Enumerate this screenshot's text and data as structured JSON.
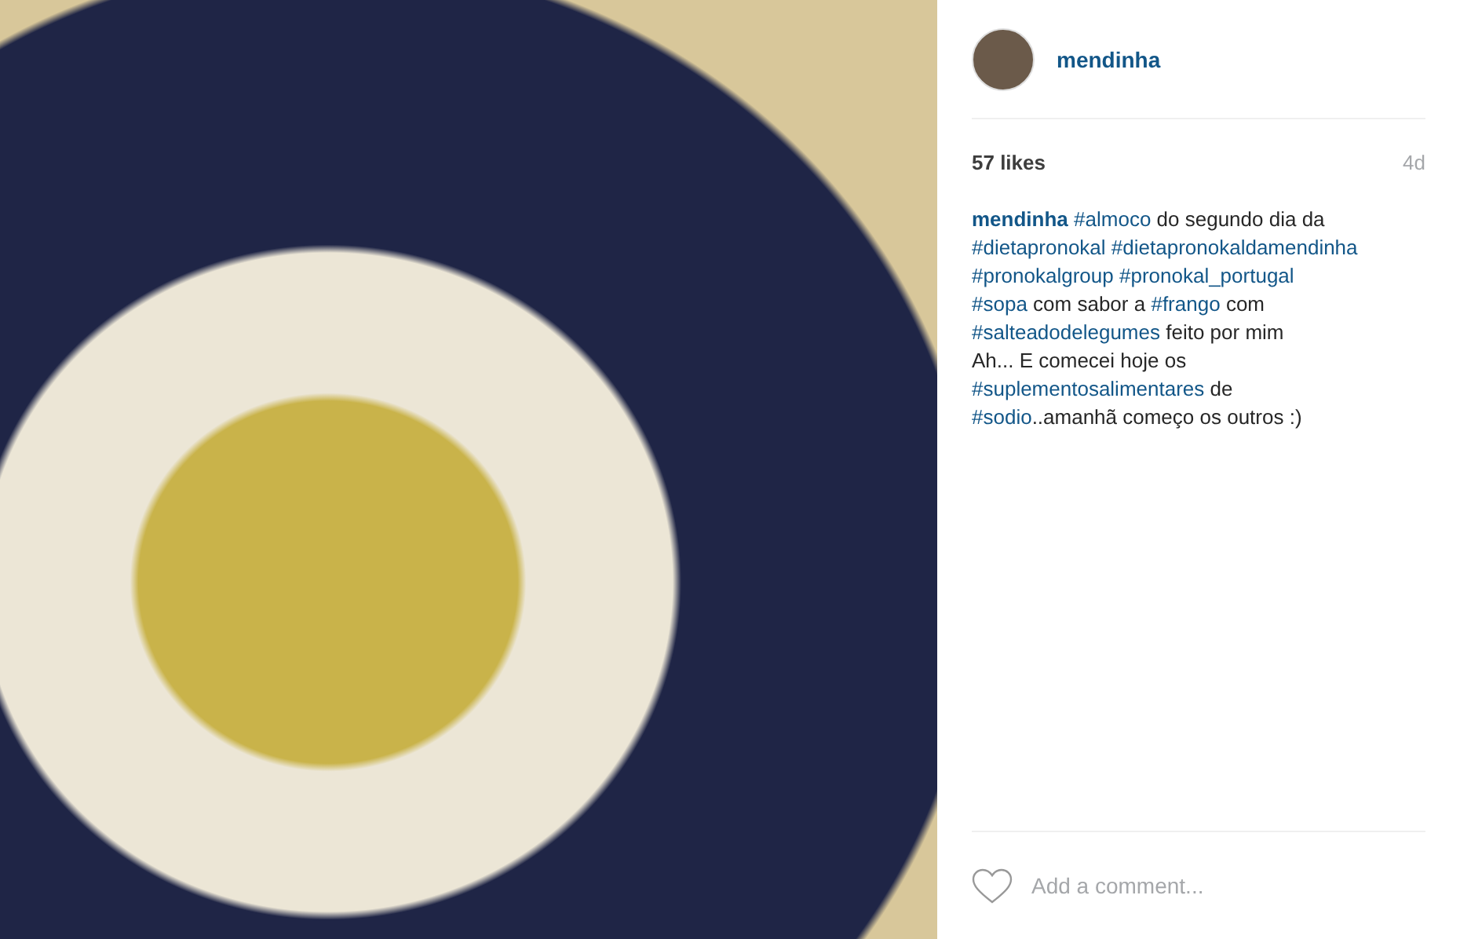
{
  "author": {
    "username": "mendinha"
  },
  "stats": {
    "likes": "57 likes",
    "age": "4d"
  },
  "caption": {
    "lines": [
      [
        {
          "kind": "user",
          "text": "mendinha"
        },
        {
          "kind": "tag",
          "text": "#almoco"
        },
        {
          "kind": "text",
          "text": "do segundo dia da"
        }
      ],
      [
        {
          "kind": "tag",
          "text": "#dietapronokal"
        },
        {
          "kind": "tag",
          "text": "#dietapronokaldamendinha"
        }
      ],
      [
        {
          "kind": "tag",
          "text": "#pronokalgroup"
        },
        {
          "kind": "tag",
          "text": "#pronokal_portugal"
        }
      ],
      [
        {
          "kind": "tag",
          "text": "#sopa"
        },
        {
          "kind": "text",
          "text": "com sabor a"
        },
        {
          "kind": "tag",
          "text": "#frango"
        },
        {
          "kind": "text",
          "text": "com"
        }
      ],
      [
        {
          "kind": "tag",
          "text": "#salteadodelegumes"
        },
        {
          "kind": "text",
          "text": "feito por mim"
        }
      ],
      [
        {
          "kind": "text",
          "text": "Ah... E comecei hoje os"
        }
      ],
      [
        {
          "kind": "tag",
          "text": "#suplementosalimentares"
        },
        {
          "kind": "text",
          "text": "de"
        }
      ],
      [
        {
          "kind": "tag",
          "text": "#sodio"
        },
        {
          "kind": "text",
          "text": "..amanhã começo os outros :)",
          "attached": true
        }
      ]
    ]
  },
  "comment": {
    "liked": false,
    "placeholder": "Add a comment..."
  }
}
